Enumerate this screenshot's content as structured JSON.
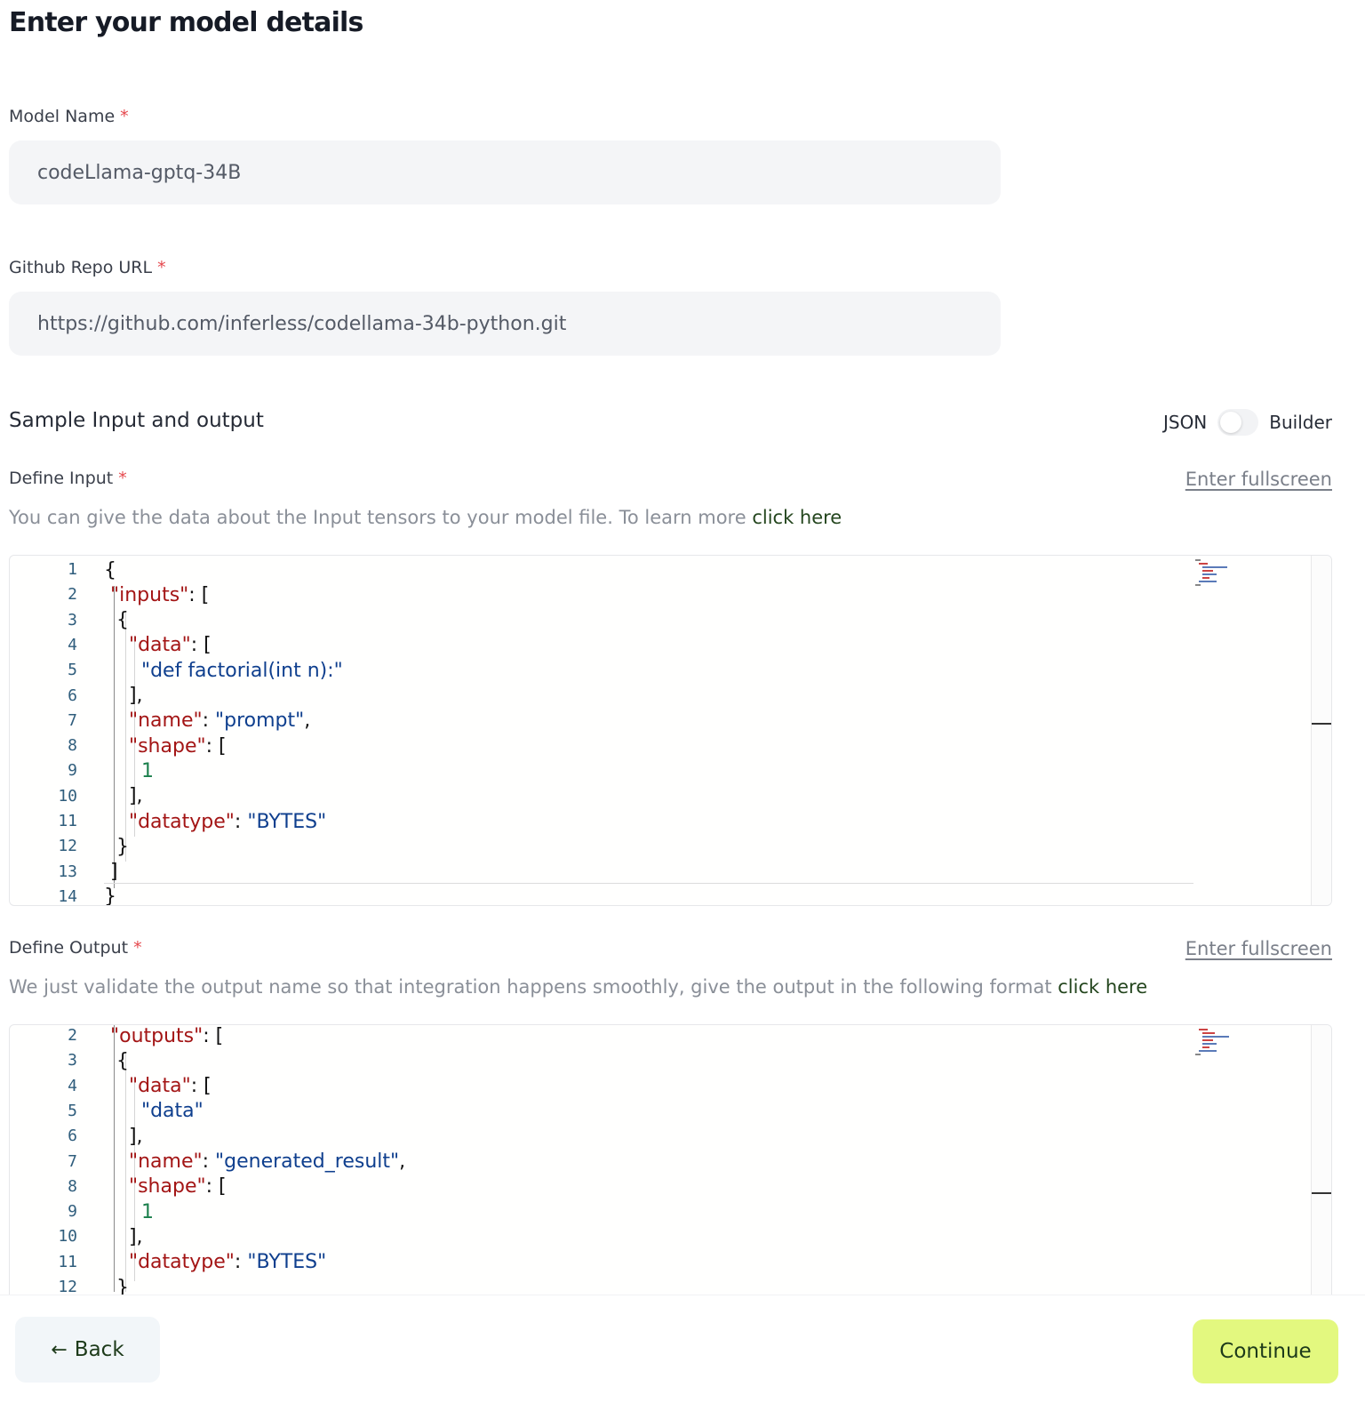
{
  "page": {
    "title": "Enter your model details"
  },
  "model_name": {
    "label": "Model Name",
    "required": "*",
    "value": "codeLlama-gptq-34B"
  },
  "github_repo": {
    "label": "Github Repo URL",
    "required": "*",
    "value": "https://github.com/inferless/codellama-34b-python.git"
  },
  "sample": {
    "title": "Sample Input and output",
    "toggle_left": "JSON",
    "toggle_right": "Builder",
    "toggle_state": "JSON"
  },
  "define_input": {
    "label": "Define Input",
    "required": "*",
    "fullscreen": "Enter fullscreen",
    "helper": "You can give the data about the Input tensors to your model file. To learn more ",
    "link": "click here",
    "lines": [
      {
        "n": "1",
        "tokens": [
          {
            "t": "{",
            "c": "p"
          }
        ]
      },
      {
        "n": "2",
        "tokens": [
          {
            "t": " \"inputs\"",
            "c": "k"
          },
          {
            "t": ": [",
            "c": "p"
          }
        ]
      },
      {
        "n": "3",
        "tokens": [
          {
            "t": "  {",
            "c": "p"
          }
        ]
      },
      {
        "n": "4",
        "tokens": [
          {
            "t": "    \"data\"",
            "c": "k"
          },
          {
            "t": ": [",
            "c": "p"
          }
        ]
      },
      {
        "n": "5",
        "tokens": [
          {
            "t": "      \"def factorial(int n):\"",
            "c": "s"
          }
        ]
      },
      {
        "n": "6",
        "tokens": [
          {
            "t": "    ],",
            "c": "p"
          }
        ]
      },
      {
        "n": "7",
        "tokens": [
          {
            "t": "    \"name\"",
            "c": "k"
          },
          {
            "t": ": ",
            "c": "p"
          },
          {
            "t": "\"prompt\"",
            "c": "s"
          },
          {
            "t": ",",
            "c": "p"
          }
        ]
      },
      {
        "n": "8",
        "tokens": [
          {
            "t": "    \"shape\"",
            "c": "k"
          },
          {
            "t": ": [",
            "c": "p"
          }
        ]
      },
      {
        "n": "9",
        "tokens": [
          {
            "t": "      1",
            "c": "n"
          }
        ]
      },
      {
        "n": "10",
        "tokens": [
          {
            "t": "    ],",
            "c": "p"
          }
        ]
      },
      {
        "n": "11",
        "tokens": [
          {
            "t": "    \"datatype\"",
            "c": "k"
          },
          {
            "t": ": ",
            "c": "p"
          },
          {
            "t": "\"BYTES\"",
            "c": "s"
          }
        ]
      },
      {
        "n": "12",
        "tokens": [
          {
            "t": "  }",
            "c": "p"
          }
        ]
      },
      {
        "n": "13",
        "tokens": [
          {
            "t": " ]",
            "c": "p"
          }
        ]
      },
      {
        "n": "14",
        "tokens": [
          {
            "t": "}",
            "c": "p"
          }
        ]
      }
    ]
  },
  "define_output": {
    "label": "Define Output",
    "required": "*",
    "fullscreen": "Enter fullscreen",
    "helper": "We just validate the output name so that integration happens smoothly, give the output in the following format ",
    "link": "click here",
    "lines": [
      {
        "n": "2",
        "tokens": [
          {
            "t": " \"outputs\"",
            "c": "k"
          },
          {
            "t": ": [",
            "c": "p"
          }
        ]
      },
      {
        "n": "3",
        "tokens": [
          {
            "t": "  {",
            "c": "p"
          }
        ]
      },
      {
        "n": "4",
        "tokens": [
          {
            "t": "    \"data\"",
            "c": "k"
          },
          {
            "t": ": [",
            "c": "p"
          }
        ]
      },
      {
        "n": "5",
        "tokens": [
          {
            "t": "      \"data\"",
            "c": "s"
          }
        ]
      },
      {
        "n": "6",
        "tokens": [
          {
            "t": "    ],",
            "c": "p"
          }
        ]
      },
      {
        "n": "7",
        "tokens": [
          {
            "t": "    \"name\"",
            "c": "k"
          },
          {
            "t": ": ",
            "c": "p"
          },
          {
            "t": "\"generated_result\"",
            "c": "s"
          },
          {
            "t": ",",
            "c": "p"
          }
        ]
      },
      {
        "n": "8",
        "tokens": [
          {
            "t": "    \"shape\"",
            "c": "k"
          },
          {
            "t": ": [",
            "c": "p"
          }
        ]
      },
      {
        "n": "9",
        "tokens": [
          {
            "t": "      1",
            "c": "n"
          }
        ]
      },
      {
        "n": "10",
        "tokens": [
          {
            "t": "    ],",
            "c": "p"
          }
        ]
      },
      {
        "n": "11",
        "tokens": [
          {
            "t": "    \"datatype\"",
            "c": "k"
          },
          {
            "t": ": ",
            "c": "p"
          },
          {
            "t": "\"BYTES\"",
            "c": "s"
          }
        ]
      },
      {
        "n": "12",
        "tokens": [
          {
            "t": "  }",
            "c": "p"
          }
        ]
      }
    ]
  },
  "footer": {
    "back_icon": "arrow-left-icon",
    "back_label": "Back",
    "continue_label": "Continue",
    "continue_color": "#e3f87f"
  }
}
